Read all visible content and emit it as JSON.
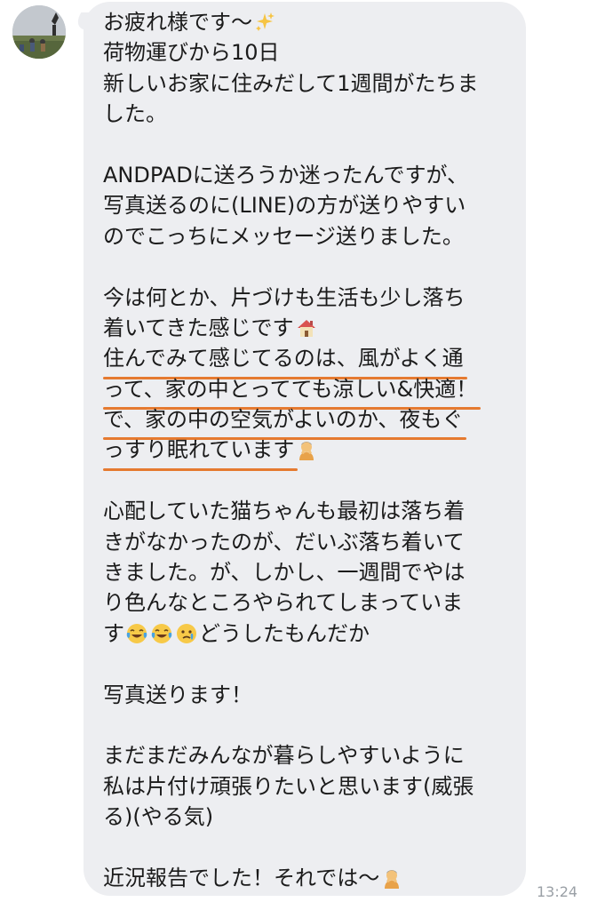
{
  "sender": {
    "avatar_name": "avatar"
  },
  "message": {
    "lines": [
      "お疲れ様です〜",
      "荷物運びから10日",
      "新しいお家に住みだして1週間がたちま",
      "した。",
      "",
      "ANDPADに送ろうか迷ったんですが、",
      "写真送るのに(LINE)の方が送りやすい",
      "のでこっちにメッセージ送りました。",
      "",
      "今は何とか、片づけも生活も少し落ち",
      "着いてきた感じです",
      "住んでみて感じてるのは、風がよく通",
      "って、家の中とってても涼しい&快適！",
      "で、家の中の空気がよいのか、夜もぐ",
      "っすり眠れています",
      "",
      "心配していた猫ちゃんも最初は落ち着",
      "きがなかったのが、だいぶ落ち着いて",
      "きました。が、しかし、一週間でやは",
      "り色んなところやられてしまっていま",
      "す",
      "どうしたもんだか",
      "",
      "写真送ります！",
      "",
      "まだまだみんなが暮らしやすいように",
      "私は片付け頑張りたいと思います(威張",
      "る)(やる気)",
      "",
      "近況報告でした！それでは〜"
    ]
  },
  "emoji": {
    "sparkles": "sparkles-icon",
    "house": "house-icon",
    "person_bowing": "person-gesture-icon",
    "tears_of_joy": "tears-of-joy-icon",
    "crying": "crying-face-icon"
  },
  "timestamp": "13:24",
  "colors": {
    "bubble": "#edeef1",
    "underline": "#e57a30",
    "text": "#1b1b1b",
    "timestamp": "#9aa0a6"
  }
}
